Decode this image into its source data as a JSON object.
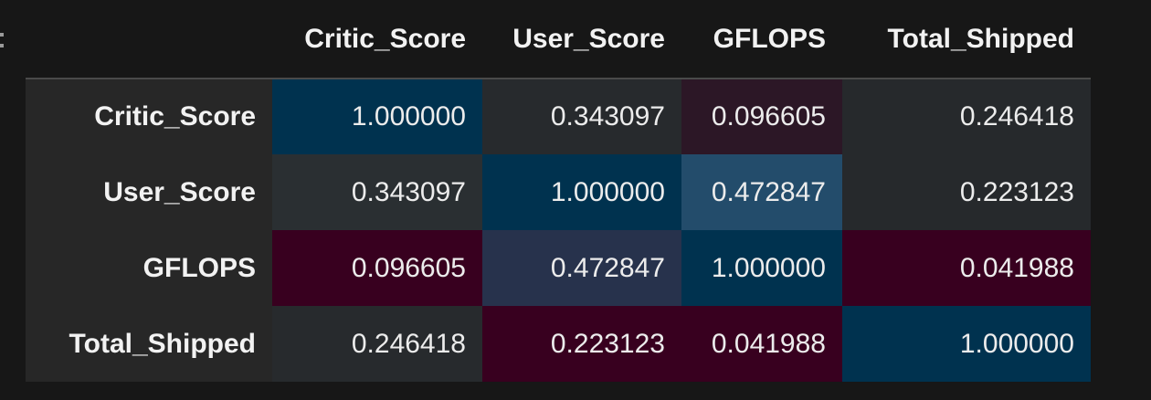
{
  "table": {
    "columns": [
      "Critic_Score",
      "User_Score",
      "GFLOPS",
      "Total_Shipped"
    ],
    "rows": [
      {
        "label": "Critic_Score",
        "values": [
          "1.000000",
          "0.343097",
          "0.096605",
          "0.246418"
        ],
        "colors": [
          "#00324f",
          "#272a2d",
          "#2c1726",
          "#26292c"
        ]
      },
      {
        "label": "User_Score",
        "values": [
          "0.343097",
          "1.000000",
          "0.472847",
          "0.223123"
        ],
        "colors": [
          "#2a2f32",
          "#00324f",
          "#234c6b",
          "#26292c"
        ]
      },
      {
        "label": "GFLOPS",
        "values": [
          "0.096605",
          "0.472847",
          "1.000000",
          "0.041988"
        ],
        "colors": [
          "#38001f",
          "#27324c",
          "#00324f",
          "#38001f"
        ]
      },
      {
        "label": "Total_Shipped",
        "values": [
          "0.246418",
          "0.223123",
          "0.041988",
          "1.000000"
        ],
        "colors": [
          "#272a2d",
          "#38001f",
          "#38001f",
          "#00324f"
        ]
      }
    ]
  },
  "theme": {
    "background": "#171717",
    "index_background": "#272727",
    "max_color": "#00324f",
    "min_color": "#38001f"
  }
}
